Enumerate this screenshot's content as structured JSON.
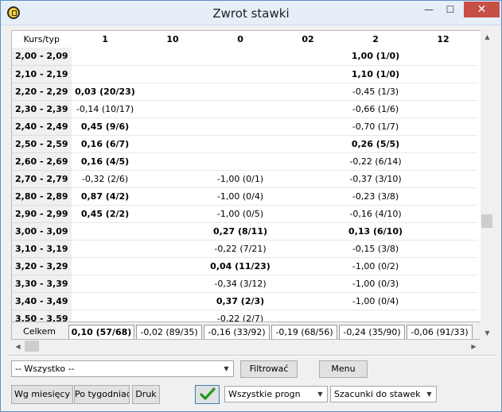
{
  "window": {
    "title": "Zwrot stawki",
    "minimize": "—",
    "maximize": "☐",
    "close": "✕"
  },
  "table": {
    "headers": [
      "Kurs/typ",
      "1",
      "10",
      "0",
      "02",
      "2",
      "12"
    ],
    "rows": [
      {
        "range": "2,00 - 2,09",
        "cells": [
          "",
          "",
          "",
          "",
          "1,00 (1/0)",
          ""
        ],
        "bold": [
          false,
          false,
          false,
          false,
          true,
          false
        ]
      },
      {
        "range": "2,10 - 2,19",
        "cells": [
          "",
          "",
          "",
          "",
          "1,10 (1/0)",
          ""
        ],
        "bold": [
          false,
          false,
          false,
          false,
          true,
          false
        ]
      },
      {
        "range": "2,20 - 2,29",
        "cells": [
          "0,03 (20/23)",
          "",
          "",
          "",
          "-0,45 (1/3)",
          ""
        ],
        "bold": [
          true,
          false,
          false,
          false,
          false,
          false
        ]
      },
      {
        "range": "2,30 - 2,39",
        "cells": [
          "-0,14 (10/17)",
          "",
          "",
          "",
          "-0,66 (1/6)",
          ""
        ],
        "bold": [
          false,
          false,
          false,
          false,
          false,
          false
        ]
      },
      {
        "range": "2,40 - 2,49",
        "cells": [
          "0,45 (9/6)",
          "",
          "",
          "",
          "-0,70 (1/7)",
          ""
        ],
        "bold": [
          true,
          false,
          false,
          false,
          false,
          false
        ]
      },
      {
        "range": "2,50 - 2,59",
        "cells": [
          "0,16 (6/7)",
          "",
          "",
          "",
          "0,26 (5/5)",
          ""
        ],
        "bold": [
          true,
          false,
          false,
          false,
          true,
          false
        ]
      },
      {
        "range": "2,60 - 2,69",
        "cells": [
          "0,16 (4/5)",
          "",
          "",
          "",
          "-0,22 (6/14)",
          ""
        ],
        "bold": [
          true,
          false,
          false,
          false,
          false,
          false
        ]
      },
      {
        "range": "2,70 - 2,79",
        "cells": [
          "-0,32 (2/6)",
          "",
          "-1,00 (0/1)",
          "",
          "-0,37 (3/10)",
          ""
        ],
        "bold": [
          false,
          false,
          false,
          false,
          false,
          false
        ]
      },
      {
        "range": "2,80 - 2,89",
        "cells": [
          "0,87 (4/2)",
          "",
          "-1,00 (0/4)",
          "",
          "-0,23 (3/8)",
          ""
        ],
        "bold": [
          true,
          false,
          false,
          false,
          false,
          false
        ]
      },
      {
        "range": "2,90 - 2,99",
        "cells": [
          "0,45 (2/2)",
          "",
          "-1,00 (0/5)",
          "",
          "-0,16 (4/10)",
          ""
        ],
        "bold": [
          true,
          false,
          false,
          false,
          false,
          false
        ]
      },
      {
        "range": "3,00 - 3,09",
        "cells": [
          "",
          "",
          "0,27 (8/11)",
          "",
          "0,13 (6/10)",
          ""
        ],
        "bold": [
          false,
          false,
          true,
          false,
          true,
          false
        ]
      },
      {
        "range": "3,10 - 3,19",
        "cells": [
          "",
          "",
          "-0,22 (7/21)",
          "",
          "-0,15 (3/8)",
          ""
        ],
        "bold": [
          false,
          false,
          false,
          false,
          false,
          false
        ]
      },
      {
        "range": "3,20 - 3,29",
        "cells": [
          "",
          "",
          "0,04 (11/23)",
          "",
          "-1,00 (0/2)",
          ""
        ],
        "bold": [
          false,
          false,
          true,
          false,
          false,
          false
        ]
      },
      {
        "range": "3,30 - 3,39",
        "cells": [
          "",
          "",
          "-0,34 (3/12)",
          "",
          "-1,00 (0/3)",
          ""
        ],
        "bold": [
          false,
          false,
          false,
          false,
          false,
          false
        ]
      },
      {
        "range": "3,40 - 3,49",
        "cells": [
          "",
          "",
          "0,37 (2/3)",
          "",
          "-1,00 (0/4)",
          ""
        ],
        "bold": [
          false,
          false,
          true,
          false,
          false,
          false
        ]
      },
      {
        "range": "3,50 - 3,59",
        "cells": [
          "",
          "",
          "-0,22 (2/7)",
          "",
          "",
          ""
        ],
        "bold": [
          false,
          false,
          false,
          false,
          false,
          false
        ]
      }
    ],
    "totals_label": "Celkem",
    "totals": [
      {
        "text": "0,10 (57/68)",
        "bold": true
      },
      {
        "text": "-0,02 (89/35)",
        "bold": false
      },
      {
        "text": "-0,16 (33/92)",
        "bold": false
      },
      {
        "text": "-0,19 (68/56)",
        "bold": false
      },
      {
        "text": "-0,24 (35/90)",
        "bold": false
      },
      {
        "text": "-0,06 (91/33)",
        "bold": false
      }
    ]
  },
  "filter": {
    "select_value": "-- Wszystko --",
    "filter_button": "Filtrować",
    "menu_button": "Menu"
  },
  "bottom": {
    "by_month": "Wg miesięcy",
    "by_week": "Po tygodniach",
    "print": "Druk",
    "forecast_select": "Wszystkie progn",
    "bet_select": "Szacunki do stawek"
  },
  "icons": {
    "dropdown": "▼",
    "scroll_up": "▲",
    "scroll_down": "▼",
    "scroll_left": "◀",
    "scroll_right": "▶"
  },
  "colors": {
    "check": "#1e9a1e",
    "close_button": "#c74f46"
  }
}
